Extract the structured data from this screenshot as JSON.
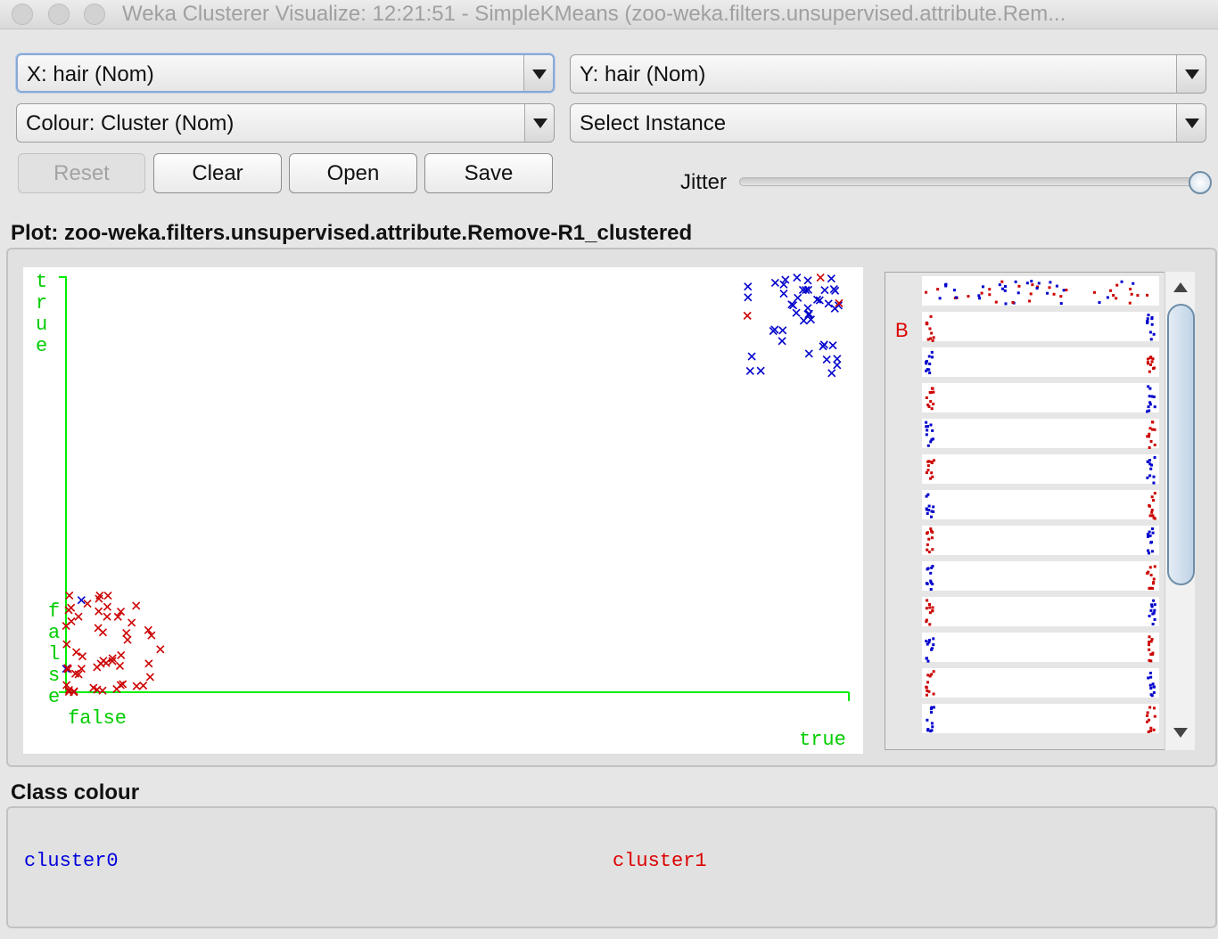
{
  "window": {
    "title": "Weka Clusterer Visualize: 12:21:51 - SimpleKMeans (zoo-weka.filters.unsupervised.attribute.Rem..."
  },
  "controls": {
    "x_axis": "X: hair (Nom)",
    "y_axis": "Y: hair (Nom)",
    "colour": "Colour: Cluster (Nom)",
    "select_instance": "Select Instance",
    "buttons": {
      "reset": "Reset",
      "clear": "Clear",
      "open": "Open",
      "save": "Save"
    },
    "jitter_label": "Jitter",
    "jitter_level": 1.0
  },
  "plot": {
    "title": "Plot: zoo-weka.filters.unsupervised.attribute.Remove-R1_clustered",
    "y_axis_label_true": "true",
    "y_axis_label_false": "false",
    "x_axis_label_false": "false",
    "x_axis_label_true": "true"
  },
  "attribute_bars": {
    "marker_label": "B",
    "row_count": 13
  },
  "class_colour": {
    "title": "Class colour",
    "items": [
      {
        "label": "cluster0",
        "color": "#0000dd"
      },
      {
        "label": "cluster1",
        "color": "#dd0000"
      }
    ]
  },
  "chart_data": {
    "type": "scatter",
    "x_attribute": "hair",
    "y_attribute": "hair",
    "categories": [
      "false",
      "true"
    ],
    "jittered": true,
    "series": [
      {
        "name": "cluster0",
        "color": "#0000cc",
        "points": [
          {
            "x": "true",
            "y": "true",
            "count": 44
          },
          {
            "x": "false",
            "y": "false",
            "count": 2
          }
        ]
      },
      {
        "name": "cluster1",
        "color": "#cc0000",
        "points": [
          {
            "x": "false",
            "y": "false",
            "count": 55
          },
          {
            "x": "true",
            "y": "true",
            "count": 3
          }
        ]
      }
    ]
  }
}
